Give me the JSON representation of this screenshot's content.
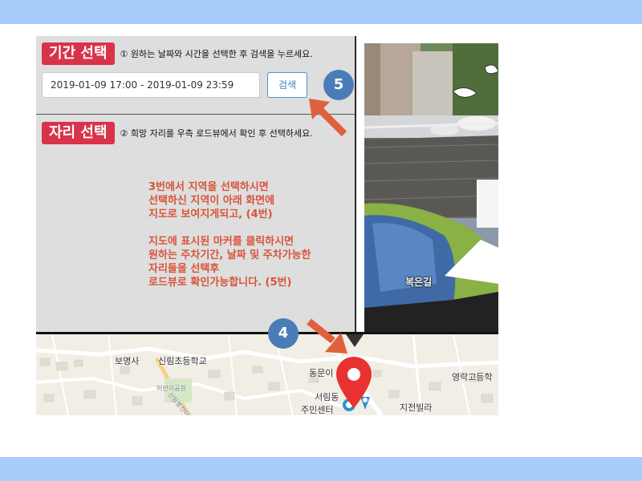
{
  "period_section": {
    "badge": "기간 선택",
    "description": "① 원하는 날짜와 시간을 선택한 후 검색을 누르세요.",
    "date_range_value": "2019-01-09 17:00 - 2019-01-09 23:59",
    "search_label": "검색"
  },
  "seat_section": {
    "badge": "자리 선택",
    "description": "② 희망 자리를 우측 로드뷰에서 확인 후 선택하세요."
  },
  "instructions": {
    "line1": "3번에서 지역을 선택하시면",
    "line2": "선택하신 지역이 아래 화면에",
    "line3": "지도로 보여지게되고, (4번)",
    "line4": "지도에 표시된 마커를 클릭하시면",
    "line5": "원하는 주차기간, 날짜 및 주차가능한",
    "line6": "자리들을 선택후",
    "line7": "로드뷰로 확인가능합니다. (5번)"
  },
  "step_markers": {
    "four": "4",
    "five": "5"
  },
  "roadview": {
    "label": "복은길"
  },
  "map": {
    "labels": {
      "bomyeongsa": "보명사",
      "sillim_elementary": "신림초등학교",
      "dongmun": "동문이",
      "seorim_dong": "서림동",
      "seorim_center": "주민센터",
      "yeonghak_high": "영락고등학",
      "jijeon_villa": "지전빌라",
      "park": "어린이공원",
      "road": "신림봉천터널(2021"
    }
  },
  "colors": {
    "band": "#a9cdfa",
    "badge": "#d8334a",
    "instruction_text": "#d8543a",
    "step_circle": "#4a7db8",
    "arrow": "#e0603e",
    "marker": "#e8322f"
  }
}
